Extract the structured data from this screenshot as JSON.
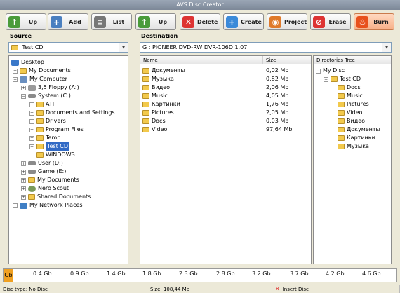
{
  "window": {
    "title": "AVS Disc Creator"
  },
  "toolbar": {
    "up1": "Up",
    "add": "Add",
    "list": "List",
    "up2": "Up",
    "delete": "Delete",
    "create": "Create",
    "project": "Project",
    "erase": "Erase",
    "burn": "Burn"
  },
  "source": {
    "label": "Source",
    "selected": "Test CD",
    "tree": [
      {
        "label": "Desktop",
        "icon": "desktop-icon"
      },
      {
        "label": "My Documents",
        "icon": "folder-icon"
      },
      {
        "label": "My Computer",
        "icon": "computer-icon"
      },
      {
        "label": "3,5 Floppy (A:)",
        "icon": "floppy-icon"
      },
      {
        "label": "System (C:)",
        "icon": "drive-icon"
      },
      {
        "label": "ATI",
        "icon": "folder-icon"
      },
      {
        "label": "Documents and Settings",
        "icon": "folder-icon"
      },
      {
        "label": "Drivers",
        "icon": "folder-icon"
      },
      {
        "label": "Program Files",
        "icon": "folder-icon"
      },
      {
        "label": "Temp",
        "icon": "folder-icon"
      },
      {
        "label": "Test CD",
        "icon": "folder-icon"
      },
      {
        "label": "WINDOWS",
        "icon": "folder-icon"
      },
      {
        "label": "User (D:)",
        "icon": "drive-icon"
      },
      {
        "label": "Game (E:)",
        "icon": "drive-icon"
      },
      {
        "label": "My Documents",
        "icon": "folder-icon"
      },
      {
        "label": "Nero Scout",
        "icon": "gear-icon"
      },
      {
        "label": "Shared Documents",
        "icon": "folder-icon"
      },
      {
        "label": "My Network Places",
        "icon": "network-icon"
      }
    ]
  },
  "destination": {
    "label": "Destination",
    "drive": "G : PIONEER  DVD-RW  DVR-106D 1.07",
    "col_name": "Name",
    "col_size": "Size",
    "files": [
      {
        "name": "Документы",
        "size": "0,02 Mb"
      },
      {
        "name": "Музыка",
        "size": "0,82 Mb"
      },
      {
        "name": "Видео",
        "size": "2,06 Mb"
      },
      {
        "name": "Music",
        "size": "4,05 Mb"
      },
      {
        "name": "Картинки",
        "size": "1,76 Mb"
      },
      {
        "name": "Pictures",
        "size": "2,05 Mb"
      },
      {
        "name": "Docs",
        "size": "0,03 Mb"
      },
      {
        "name": "Video",
        "size": "97,64 Mb"
      }
    ],
    "dirtree_header": "Directories Tree",
    "dirtree": [
      "My Disc",
      "Test CD",
      "Docs",
      "Music",
      "Pictures",
      "Video",
      "Видео",
      "Документы",
      "Картинки",
      "Музыка"
    ]
  },
  "ruler": {
    "unit": "Gb",
    "ticks": [
      "0.4 Gb",
      "0.9 Gb",
      "1.4 Gb",
      "1.8 Gb",
      "2.3 Gb",
      "2.8 Gb",
      "3.2 Gb",
      "3.7 Gb",
      "4.2 Gb",
      "4.6 Gb"
    ],
    "used_fraction": 0.01
  },
  "status": {
    "disc_type": "Disc type: No Disc",
    "size": "Size: 108,44 Mb",
    "insert": "Insert Disc"
  },
  "colors": {
    "accent": "#f0a020",
    "folder": "#f2c94c",
    "selected": "#316ac5"
  }
}
